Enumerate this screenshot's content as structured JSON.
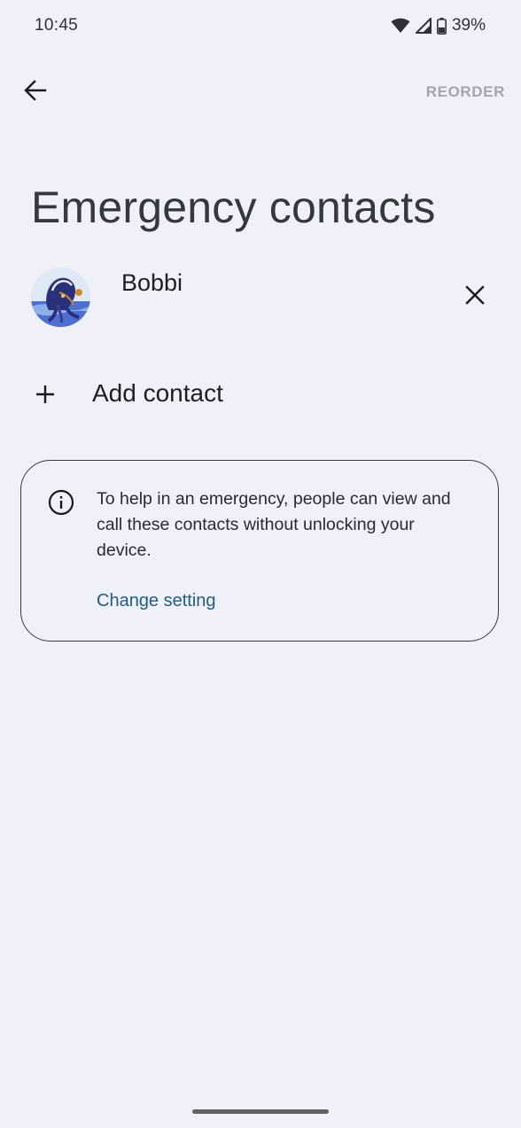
{
  "status_bar": {
    "time": "10:45",
    "battery": "39%",
    "icons": [
      "wifi-icon",
      "cell-signal-icon",
      "battery-icon"
    ]
  },
  "toolbar": {
    "back_icon": "arrow-back-icon",
    "reorder_label": "REORDER"
  },
  "page": {
    "title": "Emergency contacts"
  },
  "contacts": [
    {
      "name": "Bobbi",
      "remove_icon": "close-icon"
    }
  ],
  "add_contact": {
    "icon": "plus-icon",
    "label": "Add contact"
  },
  "info_card": {
    "icon": "info-icon",
    "text": "To help in an emergency, people can view and call these contacts without unlocking your device.",
    "link_label": "Change setting"
  },
  "colors": {
    "background": "#eff0f8",
    "title": "#35383d",
    "link": "#215d87",
    "reorder_disabled": "#a4a5ab"
  }
}
